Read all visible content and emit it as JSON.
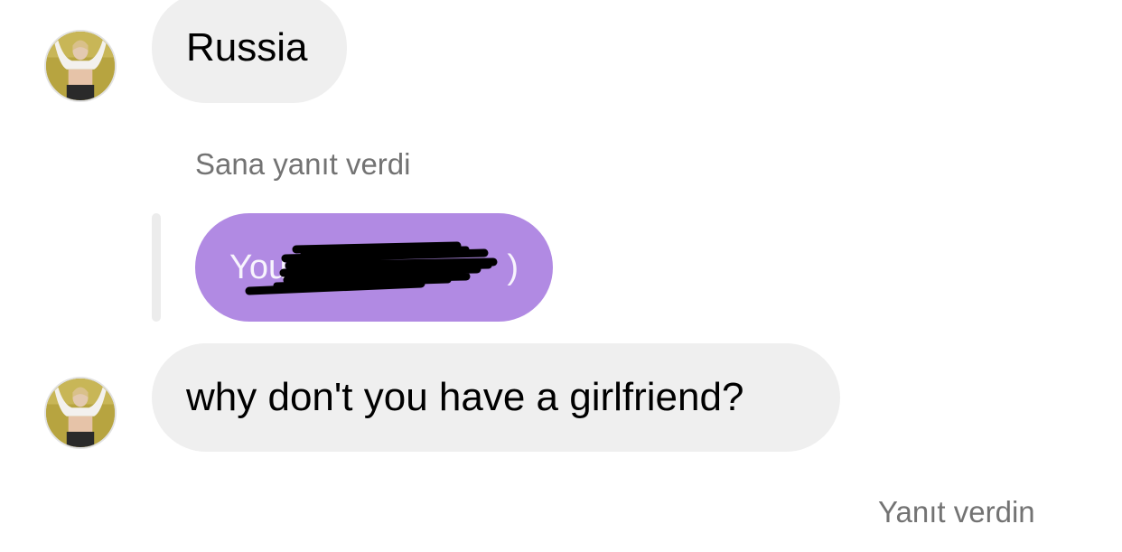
{
  "messages": [
    {
      "sender": "them",
      "text": "Russia"
    },
    {
      "sender": "them",
      "reply_label": "Sana yanıt verdi",
      "quoted_text": "You",
      "quoted_tail": ")"
    },
    {
      "sender": "them",
      "text": "why don't you have a girlfriend?"
    }
  ],
  "footer": {
    "status": "Yanıt verdin"
  },
  "colors": {
    "incoming_bubble": "#efefef",
    "quoted_bubble": "#b18ae3",
    "muted_text": "#737373"
  },
  "icons": {
    "avatar": "profile-photo",
    "redaction": "scribble-redaction"
  }
}
